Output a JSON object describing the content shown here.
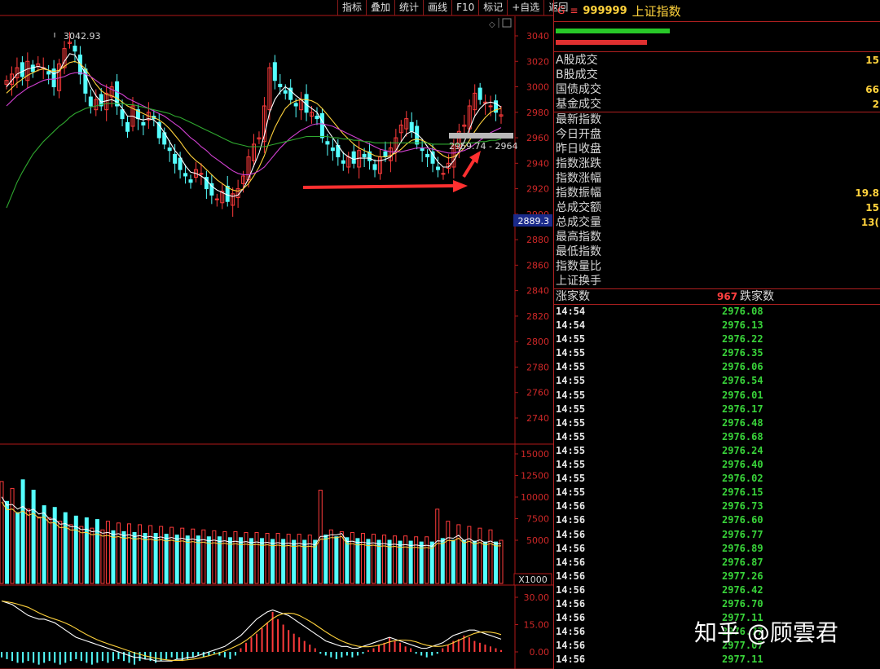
{
  "toolbar": {
    "items": [
      "指标",
      "叠加",
      "统计",
      "画线",
      "F10",
      "标记",
      "+自选",
      "返回"
    ]
  },
  "chart_data": [
    {
      "type": "line",
      "panel": "K线主图",
      "y_ticks": [
        3040,
        3020,
        3000,
        2980,
        2960,
        2940,
        2920,
        2900,
        2880,
        2860,
        2840,
        2820,
        2800,
        2780,
        2760,
        2740
      ],
      "ylim": [
        2725,
        3058
      ],
      "annotations": {
        "high_label": "3042.93",
        "range_label": "2959.74 - 2964",
        "cursor_value": "2889.3"
      },
      "close": [
        3005,
        3010,
        3015,
        3008,
        3020,
        3012,
        3018,
        3015,
        3010,
        3000,
        3018,
        3030,
        3035,
        3028,
        3010,
        2995,
        2985,
        2990,
        2985,
        2995,
        3000,
        2985,
        2975,
        2965,
        2985,
        2975,
        2970,
        2980,
        2975,
        2960,
        2955,
        2950,
        2940,
        2935,
        2930,
        2925,
        2935,
        2932,
        2920,
        2915,
        2912,
        2918,
        2910,
        2916,
        2920,
        2930,
        2945,
        2955,
        2960,
        2985,
        3015,
        3005,
        3000,
        2995,
        2990,
        2985,
        2990,
        2980,
        2980,
        2975,
        2960,
        2955,
        2950,
        2945,
        2940,
        2945,
        2940,
        2950,
        2945,
        2942,
        2935,
        2945,
        2945,
        2952,
        2960,
        2970,
        2975,
        2965,
        2955,
        2950,
        2945,
        2940,
        2935,
        2932,
        2940,
        2955,
        2965,
        2970,
        2985,
        2995,
        2990,
        2988,
        2985,
        2980,
        2978
      ],
      "ma_series": [
        {
          "color": "#ffffff",
          "values": [
            3000,
            3005,
            3010,
            3012,
            3014,
            3015,
            3016,
            3015,
            3013,
            3010,
            3012,
            3020,
            3026,
            3025,
            3018,
            3010,
            3000,
            2993,
            2988,
            2989,
            2990,
            2988,
            2983,
            2977,
            2977,
            2975,
            2974,
            2975,
            2974,
            2970,
            2964,
            2957,
            2950,
            2945,
            2938,
            2933,
            2932,
            2930,
            2927,
            2922,
            2919,
            2917,
            2915,
            2914,
            2915,
            2920,
            2928,
            2938,
            2948,
            2962,
            2980,
            2990,
            2996,
            3000,
            2997,
            2993,
            2990,
            2986,
            2983,
            2980,
            2973,
            2966,
            2960,
            2954,
            2948,
            2945,
            2943,
            2944,
            2944,
            2944,
            2942,
            2942,
            2943,
            2945,
            2950,
            2957,
            2963,
            2965,
            2963,
            2959,
            2953,
            2947,
            2941,
            2937,
            2937,
            2942,
            2949,
            2957,
            2967,
            2977,
            2983,
            2987,
            2988,
            2987,
            2984
          ]
        },
        {
          "color": "#ffd23c",
          "values": [
            2995,
            2999,
            3003,
            3006,
            3009,
            3011,
            3013,
            3014,
            3013,
            3012,
            3013,
            3016,
            3019,
            3020,
            3018,
            3014,
            3008,
            3002,
            2997,
            2994,
            2993,
            2991,
            2988,
            2985,
            2983,
            2981,
            2979,
            2977,
            2976,
            2974,
            2971,
            2967,
            2962,
            2957,
            2951,
            2946,
            2942,
            2939,
            2935,
            2931,
            2927,
            2924,
            2921,
            2919,
            2918,
            2920,
            2924,
            2930,
            2937,
            2946,
            2958,
            2968,
            2976,
            2983,
            2987,
            2989,
            2990,
            2990,
            2989,
            2987,
            2983,
            2978,
            2973,
            2968,
            2963,
            2959,
            2955,
            2952,
            2950,
            2948,
            2946,
            2945,
            2945,
            2946,
            2948,
            2951,
            2955,
            2958,
            2959,
            2958,
            2956,
            2953,
            2949,
            2946,
            2944,
            2945,
            2948,
            2952,
            2958,
            2965,
            2971,
            2976,
            2980,
            2982,
            2983
          ]
        },
        {
          "color": "#d040d0",
          "values": [
            2985,
            2989,
            2993,
            2996,
            2999,
            3001,
            3003,
            3005,
            3006,
            3006,
            3007,
            3008,
            3010,
            3011,
            3011,
            3010,
            3008,
            3005,
            3002,
            3000,
            2998,
            2996,
            2994,
            2991,
            2989,
            2987,
            2985,
            2983,
            2981,
            2979,
            2977,
            2974,
            2971,
            2968,
            2964,
            2960,
            2957,
            2953,
            2950,
            2946,
            2943,
            2940,
            2937,
            2934,
            2932,
            2931,
            2931,
            2932,
            2934,
            2937,
            2942,
            2947,
            2952,
            2956,
            2960,
            2963,
            2966,
            2968,
            2970,
            2971,
            2971,
            2970,
            2969,
            2967,
            2965,
            2963,
            2961,
            2959,
            2957,
            2955,
            2953,
            2951,
            2950,
            2949,
            2949,
            2949,
            2950,
            2951,
            2952,
            2952,
            2952,
            2951,
            2950,
            2949,
            2948,
            2948,
            2949,
            2950,
            2952,
            2955,
            2958,
            2961,
            2964,
            2966,
            2968
          ]
        },
        {
          "color": "#2fa82f",
          "values": [
            2905,
            2915,
            2925,
            2933,
            2940,
            2947,
            2952,
            2957,
            2961,
            2965,
            2969,
            2972,
            2976,
            2979,
            2981,
            2983,
            2984,
            2985,
            2986,
            2987,
            2987,
            2987,
            2987,
            2986,
            2986,
            2985,
            2984,
            2983,
            2982,
            2981,
            2980,
            2979,
            2977,
            2976,
            2974,
            2972,
            2970,
            2968,
            2966,
            2964,
            2962,
            2960,
            2958,
            2956,
            2955,
            2954,
            2953,
            2953,
            2953,
            2953,
            2954,
            2955,
            2956,
            2957,
            2958,
            2959,
            2960,
            2961,
            2961,
            2961,
            2961,
            2961,
            2960,
            2960,
            2959,
            2959,
            2958,
            2958,
            2957,
            2957,
            2956,
            2956,
            2956,
            2956,
            2956,
            2956,
            2956,
            2956,
            2956,
            2956,
            2956,
            2955,
            2955,
            2955,
            2955,
            2955,
            2955,
            2956,
            2956,
            2956,
            2957,
            2957,
            2958,
            2958,
            2959
          ]
        }
      ]
    },
    {
      "type": "bar",
      "panel": "成交量",
      "y_ticks": [
        15000,
        12500,
        10000,
        7500,
        5000
      ],
      "unit_label": "X1000",
      "ylim": [
        0,
        16500
      ],
      "values": [
        11800,
        9500,
        11000,
        8200,
        12000,
        8600,
        10800,
        7700,
        9000,
        7600,
        8800,
        7200,
        8200,
        6800,
        7800,
        6600,
        7600,
        6400,
        7400,
        6200,
        7200,
        6100,
        7000,
        6000,
        6900,
        5900,
        6800,
        5800,
        6700,
        5800,
        6600,
        5700,
        6500,
        5600,
        6400,
        5500,
        6300,
        5500,
        6200,
        5400,
        6100,
        5400,
        6000,
        5300,
        6000,
        5300,
        5900,
        5200,
        5900,
        5200,
        5800,
        5100,
        5800,
        5100,
        5700,
        5000,
        5700,
        5000,
        5600,
        5000,
        10800,
        5600,
        6200,
        5400,
        6000,
        5300,
        5900,
        5200,
        5800,
        5100,
        5700,
        5000,
        5600,
        5000,
        5500,
        4900,
        5500,
        4900,
        5400,
        4800,
        5400,
        4800,
        8600,
        5200,
        7200,
        5000,
        6800,
        5000,
        6600,
        4900,
        6400,
        4800,
        6200,
        4800,
        5000
      ],
      "up": [
        true,
        false,
        true,
        false,
        false,
        true,
        false,
        true,
        false,
        true,
        false,
        true,
        false,
        true,
        false,
        true,
        false,
        true,
        false,
        true,
        true,
        false,
        true,
        false,
        true,
        false,
        true,
        false,
        true,
        false,
        true,
        false,
        true,
        false,
        true,
        false,
        true,
        false,
        true,
        false,
        true,
        false,
        true,
        false,
        true,
        false,
        true,
        false,
        true,
        false,
        true,
        false,
        true,
        false,
        true,
        false,
        true,
        false,
        true,
        false,
        true,
        false,
        true,
        false,
        true,
        false,
        true,
        false,
        true,
        false,
        true,
        false,
        true,
        false,
        true,
        false,
        true,
        false,
        true,
        false,
        true,
        false,
        true,
        false,
        true,
        false,
        true,
        false,
        true,
        false,
        true,
        false,
        true,
        false,
        true
      ]
    },
    {
      "type": "bar",
      "panel": "MACD",
      "y_ticks": [
        "30.00",
        "15.00",
        "0.00"
      ],
      "ylim": [
        -8,
        36
      ],
      "bars": [
        -3,
        -4,
        -5,
        -6,
        -6,
        -5,
        -6,
        -7,
        -6,
        -5,
        -6,
        -7,
        -6,
        -5,
        -4,
        -5,
        -6,
        -7,
        -6,
        -5,
        -6,
        -5,
        -4,
        -5,
        -6,
        -7,
        -5,
        -4,
        -5,
        -6,
        -5,
        -4,
        -3,
        -4,
        -5,
        -4,
        -3,
        -2,
        -3,
        -2,
        -1,
        -2,
        -3,
        -4,
        -2,
        2,
        5,
        8,
        10,
        13,
        16,
        22,
        18,
        15,
        12,
        10,
        8,
        6,
        4,
        2,
        -1,
        -2,
        -3,
        -4,
        -3,
        -2,
        -3,
        -2,
        -1,
        1,
        2,
        4,
        5,
        8,
        6,
        5,
        3,
        2,
        -1,
        -2,
        -3,
        -2,
        -1,
        2,
        4,
        6,
        7,
        9,
        8,
        6,
        5,
        4,
        3,
        2,
        1
      ],
      "dif": [
        28,
        27,
        26,
        24,
        22,
        20,
        19,
        18,
        18,
        17,
        16,
        14,
        12,
        10,
        8,
        7,
        6,
        5,
        4,
        3,
        2,
        1,
        0,
        -1,
        -2,
        -3,
        -3,
        -4,
        -4,
        -5,
        -5,
        -5,
        -5,
        -4,
        -4,
        -3,
        -3,
        -2,
        -1,
        0,
        1,
        2,
        3,
        5,
        7,
        9,
        12,
        15,
        18,
        20,
        22,
        23,
        22,
        21,
        20,
        18,
        16,
        14,
        12,
        10,
        8,
        6,
        5,
        4,
        3,
        3,
        2,
        2,
        3,
        4,
        5,
        6,
        7,
        8,
        7,
        6,
        5,
        4,
        3,
        2,
        2,
        3,
        4,
        5,
        7,
        9,
        10,
        11,
        12,
        12,
        11,
        10,
        9,
        8,
        7
      ]
    }
  ],
  "right_panel": {
    "header": {
      "menu": "G",
      "code": "999999",
      "name": "上证指数"
    },
    "bars": [
      {
        "color": "#28c828",
        "width_pct": 0.35
      },
      {
        "color": "#e03030",
        "width_pct": 0.28
      }
    ],
    "stats_group1": [
      {
        "label": "A股成交",
        "value": "15"
      },
      {
        "label": "B股成交",
        "value": ""
      },
      {
        "label": "国债成交",
        "value": "66"
      },
      {
        "label": "基金成交",
        "value": "2"
      }
    ],
    "stats_group2": [
      {
        "label": "最新指数",
        "value": ""
      },
      {
        "label": "今日开盘",
        "value": ""
      },
      {
        "label": "昨日收盘",
        "value": ""
      },
      {
        "label": "指数涨跌",
        "value": ""
      },
      {
        "label": "指数涨幅",
        "value": ""
      },
      {
        "label": "指数振幅",
        "value": "19.8"
      },
      {
        "label": "总成交额",
        "value": "15"
      },
      {
        "label": "总成交量",
        "value": "13("
      },
      {
        "label": "最高指数",
        "value": ""
      },
      {
        "label": "最低指数",
        "value": ""
      },
      {
        "label": "指数量比",
        "value": ""
      },
      {
        "label": "上证换手",
        "value": ""
      }
    ],
    "adv_dec": {
      "up_label": "涨家数",
      "count": "967",
      "down_label": "跌家数"
    },
    "ticks": [
      {
        "time": "14:54",
        "price": "2976.08"
      },
      {
        "time": "14:54",
        "price": "2976.13"
      },
      {
        "time": "14:55",
        "price": "2976.22"
      },
      {
        "time": "14:55",
        "price": "2976.35"
      },
      {
        "time": "14:55",
        "price": "2976.06"
      },
      {
        "time": "14:55",
        "price": "2976.54"
      },
      {
        "time": "14:55",
        "price": "2976.01"
      },
      {
        "time": "14:55",
        "price": "2976.17"
      },
      {
        "time": "14:55",
        "price": "2976.48"
      },
      {
        "time": "14:55",
        "price": "2976.68"
      },
      {
        "time": "14:55",
        "price": "2976.24"
      },
      {
        "time": "14:55",
        "price": "2976.40"
      },
      {
        "time": "14:55",
        "price": "2976.02"
      },
      {
        "time": "14:55",
        "price": "2976.15"
      },
      {
        "time": "14:56",
        "price": "2976.73"
      },
      {
        "time": "14:56",
        "price": "2976.60"
      },
      {
        "time": "14:56",
        "price": "2976.77"
      },
      {
        "time": "14:56",
        "price": "2976.89"
      },
      {
        "time": "14:56",
        "price": "2976.87"
      },
      {
        "time": "14:56",
        "price": "2977.26"
      },
      {
        "time": "14:56",
        "price": "2976.42"
      },
      {
        "time": "14:56",
        "price": "2976.70"
      },
      {
        "time": "14:56",
        "price": "2977.11"
      },
      {
        "time": "14:56",
        "price": "2976.77"
      },
      {
        "time": "14:56",
        "price": "2977.07"
      },
      {
        "time": "14:56",
        "price": "2977.11"
      }
    ]
  },
  "watermark": "知乎 @顾雲君",
  "colors": {
    "up": "#ff3b3b",
    "down": "#54ffff",
    "grid": "#b01818",
    "axis_text": "#d02828",
    "arrow": "#ff3030"
  }
}
